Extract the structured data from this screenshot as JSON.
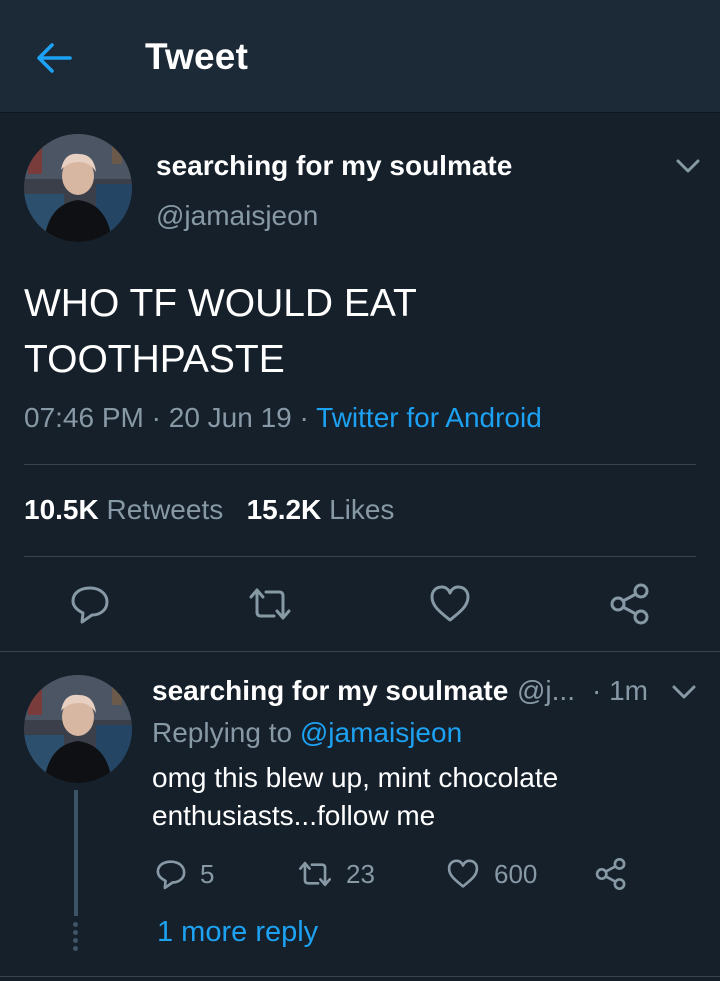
{
  "header": {
    "title": "Tweet"
  },
  "tweet": {
    "display_name": "searching for my soulmate",
    "handle": "@jamaisjeon",
    "text": "WHO TF WOULD EAT TOOTHPASTE",
    "time": "07:46 PM",
    "date": "20 Jun 19",
    "source": "Twitter for Android",
    "separator": " · ",
    "retweets_count": "10.5K",
    "retweets_label": "Retweets",
    "likes_count": "15.2K",
    "likes_label": "Likes"
  },
  "reply": {
    "display_name": "searching for my soulmate",
    "handle": "@j...",
    "age": "· 1m",
    "replying_prefix": "Replying to",
    "replying_to": "@jamaisjeon",
    "text": "omg this blew up, mint chocolate enthusiasts...follow me",
    "reply_count": "5",
    "retweet_count": "23",
    "like_count": "600"
  },
  "more_replies": "1 more reply",
  "colors": {
    "background": "#15202b",
    "header": "#1c2936",
    "accent": "#1da1f2",
    "secondary_text": "#8899a6",
    "divider": "#38444d"
  },
  "icons": {
    "back": "arrow-left-icon",
    "chevron": "chevron-down-icon",
    "reply": "comment-bubble-icon",
    "retweet": "retweet-icon",
    "like": "heart-icon",
    "share": "share-icon"
  }
}
